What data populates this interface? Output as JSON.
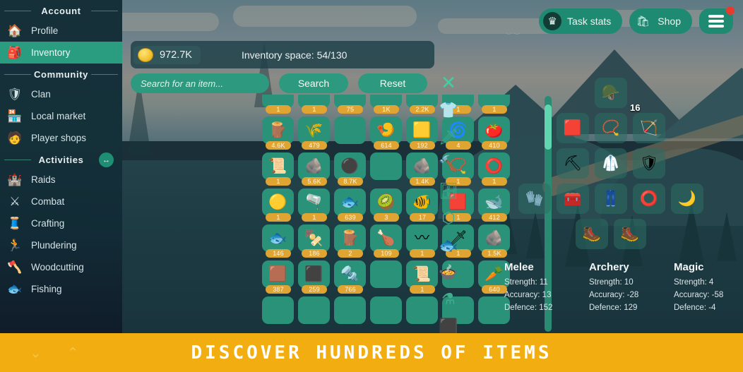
{
  "sidebar": {
    "sections": [
      {
        "title": "Account",
        "items": [
          {
            "label": "Profile",
            "icon": "house-icon",
            "glyph": "🏠",
            "active": false
          },
          {
            "label": "Inventory",
            "icon": "backpack-icon",
            "glyph": "🎒",
            "active": true
          }
        ]
      },
      {
        "title": "Community",
        "items": [
          {
            "label": "Clan",
            "icon": "shield-icon",
            "glyph": "🛡",
            "active": false
          },
          {
            "label": "Local market",
            "icon": "store-icon",
            "glyph": "🏪",
            "active": false
          },
          {
            "label": "Player shops",
            "icon": "player-shop-icon",
            "glyph": "🧑",
            "active": false
          }
        ]
      },
      {
        "title": "Activities",
        "toggle_icon": "expand-collapse-icon",
        "toggle_glyph": "↔",
        "items": [
          {
            "label": "Raids",
            "icon": "castle-icon",
            "glyph": "🏰",
            "active": false
          },
          {
            "label": "Combat",
            "icon": "sword-shield-icon",
            "glyph": "⚔",
            "active": false
          },
          {
            "label": "Crafting",
            "icon": "crafting-icon",
            "glyph": "🧵",
            "active": false
          },
          {
            "label": "Plundering",
            "icon": "thief-icon",
            "glyph": "🏃",
            "active": false
          },
          {
            "label": "Woodcutting",
            "icon": "axe-log-icon",
            "glyph": "🪓",
            "active": false
          },
          {
            "label": "Fishing",
            "icon": "fish-icon",
            "glyph": "🐟",
            "active": false
          }
        ]
      }
    ]
  },
  "header": {
    "task_stats_label": "Task stats",
    "task_stats_icon": "crown-icon",
    "task_stats_glyph": "♛",
    "shop_label": "Shop",
    "shop_icon": "shopping-bag-icon",
    "shop_glyph": "🛍",
    "menu_icon": "hamburger-menu-icon",
    "notification_badge_color": "#e83b2f"
  },
  "hud": {
    "gold_icon": "gold-coin-icon",
    "gold_amount": "972.7K",
    "inventory_space": "Inventory space: 54/130"
  },
  "search": {
    "placeholder": "Search for an item...",
    "value": "",
    "search_label": "Search",
    "reset_label": "Reset"
  },
  "inventory": {
    "rows": [
      [
        {
          "glyph": "",
          "count": "1",
          "name": "item-slot"
        },
        {
          "glyph": "",
          "count": "1",
          "name": "item-slot"
        },
        {
          "glyph": "",
          "count": "75",
          "name": "item-slot"
        },
        {
          "glyph": "",
          "count": "1K",
          "name": "item-slot"
        },
        {
          "glyph": "",
          "count": "2.2K",
          "name": "item-slot"
        },
        {
          "glyph": "",
          "count": "1",
          "name": "item-slot"
        },
        {
          "glyph": "",
          "count": "1",
          "name": "item-slot"
        }
      ],
      [
        {
          "glyph": "🪵",
          "count": "4.6K",
          "name": "log-item"
        },
        {
          "glyph": "🌾",
          "count": "479",
          "name": "herb-item"
        },
        {
          "glyph": "",
          "count": "",
          "name": "empty-slot"
        },
        {
          "glyph": "🍤",
          "count": "614",
          "name": "shrimp-item"
        },
        {
          "glyph": "🟨",
          "count": "192",
          "name": "gold-bar-item"
        },
        {
          "glyph": "🌀",
          "count": "4",
          "name": "air-rune-item"
        },
        {
          "glyph": "🍅",
          "count": "410",
          "name": "tomato-item"
        }
      ],
      [
        {
          "glyph": "📜",
          "count": "1",
          "name": "scroll-item"
        },
        {
          "glyph": "🪨",
          "count": "5.6K",
          "name": "copper-ore-item"
        },
        {
          "glyph": "⚫",
          "count": "8.7K",
          "name": "coal-item"
        },
        {
          "glyph": "",
          "count": "",
          "name": "empty-slot"
        },
        {
          "glyph": "🪨",
          "count": "1.4K",
          "name": "silver-ore-item"
        },
        {
          "glyph": "📿",
          "count": "1",
          "name": "amulet-item"
        },
        {
          "glyph": "⭕",
          "count": "1",
          "name": "ring-item"
        }
      ],
      [
        {
          "glyph": "🟡",
          "count": "1",
          "name": "bracelet-item"
        },
        {
          "glyph": "🫗",
          "count": "1",
          "name": "potion-item"
        },
        {
          "glyph": "🐟",
          "count": "639",
          "name": "fish-item"
        },
        {
          "glyph": "🥝",
          "count": "3",
          "name": "kiwi-item"
        },
        {
          "glyph": "🐠",
          "count": "17",
          "name": "cooked-fish-item"
        },
        {
          "glyph": "🟥",
          "count": "1",
          "name": "cape-item"
        },
        {
          "glyph": "🐋",
          "count": "412",
          "name": "whale-item"
        }
      ],
      [
        {
          "glyph": "🐟",
          "count": "146",
          "name": "fish-item"
        },
        {
          "glyph": "🍢",
          "count": "186",
          "name": "skewer-item"
        },
        {
          "glyph": "🪵",
          "count": "2",
          "name": "log-item"
        },
        {
          "glyph": "🍗",
          "count": "109",
          "name": "cooked-item"
        },
        {
          "glyph": "〰",
          "count": "1",
          "name": "rope-item"
        },
        {
          "glyph": "🗡",
          "count": "1",
          "name": "spear-item"
        },
        {
          "glyph": "🪨",
          "count": "1.5K",
          "name": "ore-item"
        }
      ],
      [
        {
          "glyph": "🟫",
          "count": "387",
          "name": "bronze-bar-item"
        },
        {
          "glyph": "⬛",
          "count": "259",
          "name": "iron-bar-item"
        },
        {
          "glyph": "🔩",
          "count": "766",
          "name": "metal-item"
        },
        {
          "glyph": "",
          "count": "",
          "name": "empty-slot"
        },
        {
          "glyph": "📜",
          "count": "1",
          "name": "pickaxe-scroll-item"
        },
        {
          "glyph": "",
          "count": "",
          "name": "empty-slot"
        },
        {
          "glyph": "🥕",
          "count": "640",
          "name": "carrot-item"
        }
      ],
      [
        {
          "glyph": "",
          "count": "",
          "name": "empty-slot"
        },
        {
          "glyph": "",
          "count": "",
          "name": "empty-slot"
        },
        {
          "glyph": "",
          "count": "",
          "name": "empty-slot"
        },
        {
          "glyph": "",
          "count": "",
          "name": "empty-slot"
        },
        {
          "glyph": "",
          "count": "",
          "name": "empty-slot"
        },
        {
          "glyph": "",
          "count": "",
          "name": "empty-slot"
        },
        {
          "glyph": "",
          "count": "",
          "name": "empty-slot"
        }
      ]
    ]
  },
  "filter_tools": [
    {
      "name": "close-icon",
      "glyph": "✕"
    },
    {
      "name": "shirt-icon",
      "glyph": "👕"
    },
    {
      "name": "sword-icon",
      "glyph": "🗡"
    },
    {
      "name": "hammer-icon",
      "glyph": "🔨"
    },
    {
      "name": "chest-icon",
      "glyph": "🗄"
    },
    {
      "name": "gem-icon",
      "glyph": "⬡"
    },
    {
      "name": "fish-icon",
      "glyph": "🐟"
    },
    {
      "name": "cooked-meal-icon",
      "glyph": "🍲"
    },
    {
      "name": "potion-flask-icon",
      "glyph": "⚗"
    },
    {
      "name": "cube-icon",
      "glyph": "⬛"
    }
  ],
  "equipment": {
    "rows": [
      [
        {
          "name": "helmet-slot",
          "glyph": "🪖",
          "count": ""
        }
      ],
      [
        {
          "name": "cape-slot",
          "glyph": "🟥",
          "count": ""
        },
        {
          "name": "amulet-slot",
          "glyph": "📿",
          "count": ""
        },
        {
          "name": "ammo-slot",
          "glyph": "🏹",
          "count": "16"
        }
      ],
      [
        {
          "name": "weapon-slot",
          "glyph": "⛏",
          "count": ""
        },
        {
          "name": "body-slot",
          "glyph": "🥼",
          "count": ""
        },
        {
          "name": "shield-slot",
          "glyph": "🛡",
          "count": ""
        }
      ],
      [
        {
          "name": "gloves-slot",
          "glyph": "🧤",
          "count": ""
        },
        {
          "name": "tool-belt-slot",
          "glyph": "🧰",
          "count": ""
        },
        {
          "name": "legs-slot",
          "glyph": "👖",
          "count": ""
        },
        {
          "name": "ring-slot",
          "glyph": "⭕",
          "count": ""
        },
        {
          "name": "bracelet-slot",
          "glyph": "🌙",
          "count": ""
        }
      ],
      [
        {
          "name": "boots-slot",
          "glyph": "🥾",
          "count": ""
        },
        {
          "name": "secondary-boots-slot",
          "glyph": "🥾",
          "count": ""
        }
      ]
    ]
  },
  "stats": {
    "columns": [
      {
        "title": "Melee",
        "strength": "Strength: 11",
        "accuracy": "Accuracy: 13",
        "defence": "Defence: 152"
      },
      {
        "title": "Archery",
        "strength": "Strength: 10",
        "accuracy": "Accuracy: -28",
        "defence": "Defence: 129"
      },
      {
        "title": "Magic",
        "strength": "Strength: 4",
        "accuracy": "Accuracy: -58",
        "defence": "Defence: -4"
      }
    ]
  },
  "banner": {
    "text": "DISCOVER HUNDREDS OF ITEMS",
    "background_color": "#f2ad10",
    "down_arrow_icon": "chevron-down-icon",
    "down_arrow_glyph": "⌄",
    "up_arrow_icon": "chevron-up-icon",
    "up_arrow_glyph": "⌃"
  }
}
